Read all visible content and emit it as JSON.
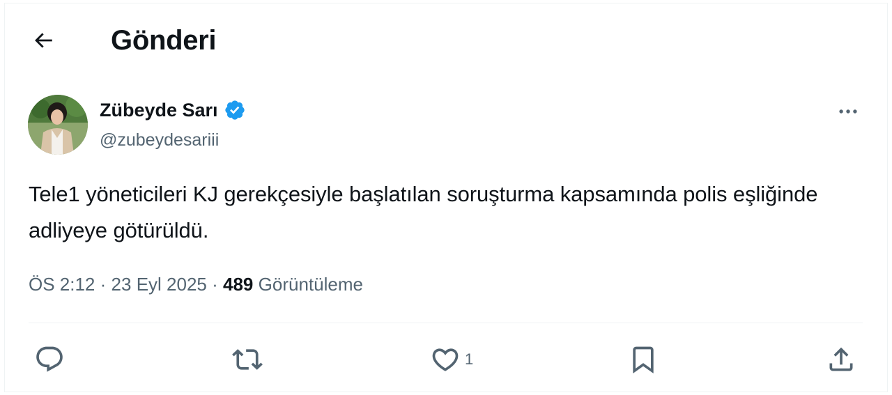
{
  "header": {
    "title": "Gönderi",
    "back_icon": "arrow-left-icon"
  },
  "tweet": {
    "author": {
      "display_name": "Zübeyde Sarı",
      "handle": "@zubeydesariii",
      "verified": true,
      "verified_color": "#1d9bf0"
    },
    "text": "Tele1 yöneticileri KJ gerekçesiyle başlatılan soruşturma kapsamında polis eşliğinde adliyeye götürüldü.",
    "time": "ÖS 2:12",
    "separator": "·",
    "date": "23 Eyl 2025",
    "views_count": "489",
    "views_label": "Görüntüleme"
  },
  "actions": {
    "reply": {
      "icon": "reply-icon"
    },
    "repost": {
      "icon": "repost-icon"
    },
    "like": {
      "icon": "heart-icon",
      "count": "1"
    },
    "bookmark": {
      "icon": "bookmark-icon"
    },
    "share": {
      "icon": "share-icon"
    }
  },
  "colors": {
    "text_primary": "#0f1419",
    "text_secondary": "#536471",
    "border": "#eff3f4",
    "accent": "#1d9bf0"
  }
}
